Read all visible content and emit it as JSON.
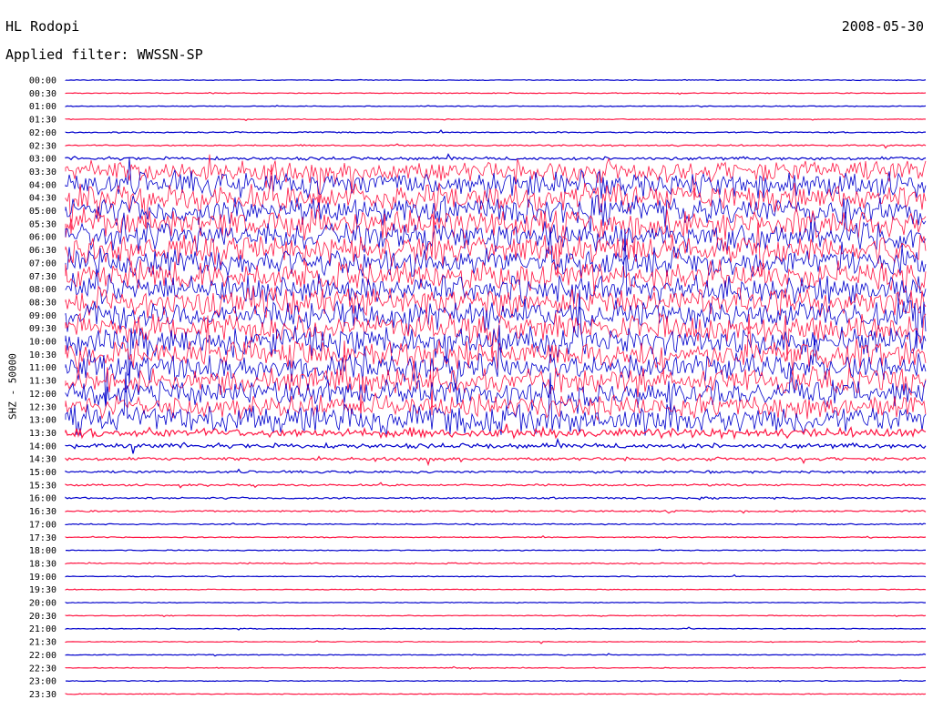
{
  "header": {
    "station": "HL Rodopi",
    "filter": "Applied filter: WWSSN-SP",
    "date": "2008-05-30",
    "channel": "SHZ - 50000"
  },
  "colors": {
    "odd": "#0000cc",
    "even": "#ff1744"
  },
  "chart_data": {
    "type": "line",
    "title": "HL Rodopi",
    "subtitle": "Applied filter: WWSSN-SP",
    "ylabel": "SHZ - 50000",
    "grid": false,
    "legend": "none",
    "rows": [
      {
        "label": "00:00",
        "level": 0.05
      },
      {
        "label": "00:30",
        "level": 0.05
      },
      {
        "label": "01:00",
        "level": 0.05
      },
      {
        "label": "01:30",
        "level": 0.05
      },
      {
        "label": "02:00",
        "level": 0.08
      },
      {
        "label": "02:30",
        "level": 0.1
      },
      {
        "label": "03:00",
        "level": 0.2
      },
      {
        "label": "03:30",
        "level": 1.4
      },
      {
        "label": "04:00",
        "level": 1.6
      },
      {
        "label": "04:30",
        "level": 1.7
      },
      {
        "label": "05:00",
        "level": 1.8
      },
      {
        "label": "05:30",
        "level": 1.8
      },
      {
        "label": "06:00",
        "level": 1.8
      },
      {
        "label": "06:30",
        "level": 1.8
      },
      {
        "label": "07:00",
        "level": 1.8
      },
      {
        "label": "07:30",
        "level": 1.8
      },
      {
        "label": "08:00",
        "level": 1.8
      },
      {
        "label": "08:30",
        "level": 1.8
      },
      {
        "label": "09:00",
        "level": 1.8
      },
      {
        "label": "09:30",
        "level": 1.8
      },
      {
        "label": "10:00",
        "level": 1.8
      },
      {
        "label": "10:30",
        "level": 1.8
      },
      {
        "label": "11:00",
        "level": 1.7
      },
      {
        "label": "11:30",
        "level": 1.6
      },
      {
        "label": "12:00",
        "level": 1.6
      },
      {
        "label": "12:30",
        "level": 1.5
      },
      {
        "label": "13:00",
        "level": 1.8
      },
      {
        "label": "13:30",
        "level": 0.6
      },
      {
        "label": "14:00",
        "level": 0.3
      },
      {
        "label": "14:30",
        "level": 0.2
      },
      {
        "label": "15:00",
        "level": 0.15
      },
      {
        "label": "15:30",
        "level": 0.12
      },
      {
        "label": "16:00",
        "level": 0.12
      },
      {
        "label": "16:30",
        "level": 0.1
      },
      {
        "label": "17:00",
        "level": 0.08
      },
      {
        "label": "17:30",
        "level": 0.06
      },
      {
        "label": "18:00",
        "level": 0.06
      },
      {
        "label": "18:30",
        "level": 0.08
      },
      {
        "label": "19:00",
        "level": 0.05
      },
      {
        "label": "19:30",
        "level": 0.05
      },
      {
        "label": "20:00",
        "level": 0.05
      },
      {
        "label": "20:30",
        "level": 0.05
      },
      {
        "label": "21:00",
        "level": 0.05
      },
      {
        "label": "21:30",
        "level": 0.05
      },
      {
        "label": "22:00",
        "level": 0.05
      },
      {
        "label": "22:30",
        "level": 0.05
      },
      {
        "label": "23:00",
        "level": 0.05
      },
      {
        "label": "23:30",
        "level": 0.05
      }
    ]
  }
}
